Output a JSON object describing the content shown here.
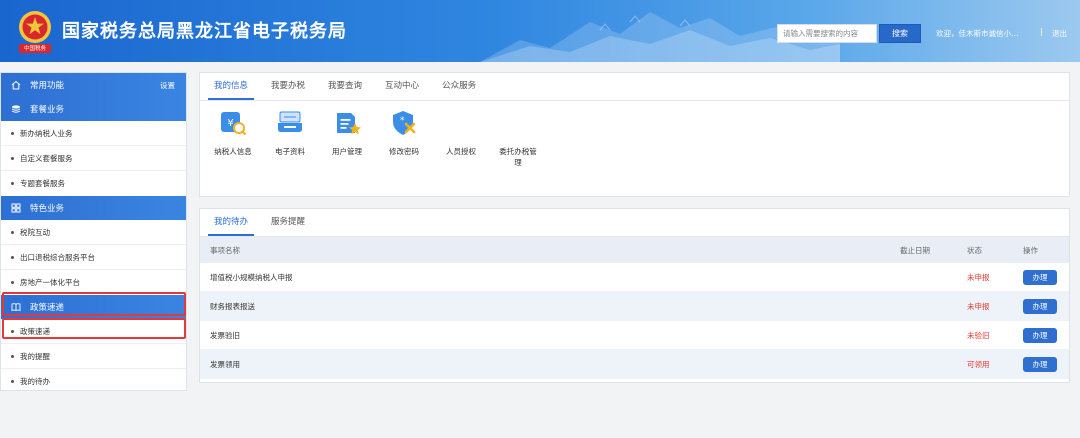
{
  "header": {
    "title": "国家税务总局黑龙江省电子税务局",
    "emblem_text": "中国税务",
    "search_placeholder": "请输入需要搜索的内容",
    "search_button": "搜索",
    "welcome": "欢迎，佳木斯市诚信小…",
    "separator": "|",
    "logout": "退出"
  },
  "sidebar": {
    "common_functions": {
      "label": "常用功能",
      "settings": "设置"
    },
    "package_business": {
      "label": "套餐业务",
      "items": [
        "新办纳税人业务",
        "自定义套餐服务",
        "专题套餐服务"
      ]
    },
    "special_business": {
      "label": "特色业务",
      "items": [
        "税院互动",
        "出口退税综合服务平台",
        "房地产一体化平台"
      ]
    },
    "policy": {
      "label": "政策速递",
      "items": [
        "政策速递",
        "我的提醒",
        "我的待办"
      ]
    }
  },
  "my_info": {
    "tabs": [
      "我的信息",
      "我要办税",
      "我要查询",
      "互动中心",
      "公众服务"
    ],
    "active_tab": 0,
    "icons": [
      {
        "label": "纳税人信息",
        "icon": "taxpayer-info-icon"
      },
      {
        "label": "电子资料",
        "icon": "electronic-data-icon"
      },
      {
        "label": "用户管理",
        "icon": "user-management-icon"
      },
      {
        "label": "修改密码",
        "icon": "change-password-icon"
      },
      {
        "label": "人员授权",
        "icon": "none"
      },
      {
        "label": "委托办税管理",
        "icon": "none"
      }
    ]
  },
  "todo": {
    "tabs": [
      "我的待办",
      "服务提醒"
    ],
    "active_tab": 0,
    "columns": {
      "name": "事项名称",
      "deadline": "截止日期",
      "status": "状态",
      "action": "操作"
    },
    "rows": [
      {
        "name": "增值税小规模纳税人申报",
        "deadline": "",
        "status": "未申报",
        "action": "办理"
      },
      {
        "name": "财务报表报送",
        "deadline": "",
        "status": "未申报",
        "action": "办理"
      },
      {
        "name": "发票验旧",
        "deadline": "",
        "status": "未验旧",
        "action": "办理"
      },
      {
        "name": "发票领用",
        "deadline": "",
        "status": "可领用",
        "action": "办理"
      }
    ]
  },
  "colors": {
    "primary": "#2c6fd5",
    "highlight_box": "#e4393c",
    "status_alert": "#e03a2f",
    "icon_blue": "#3a8ee8"
  }
}
